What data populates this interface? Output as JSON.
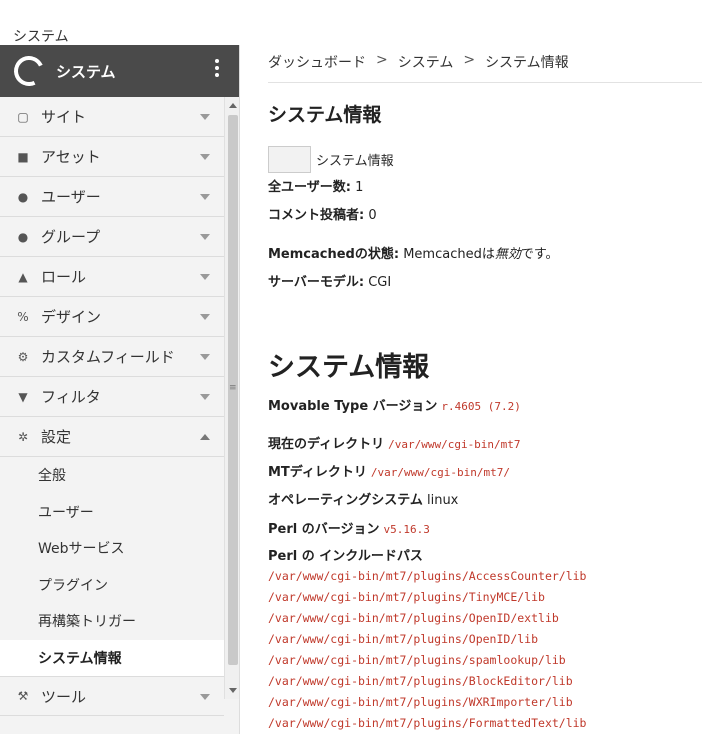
{
  "top_label": "システム",
  "sidebar": {
    "title": "システム",
    "items": [
      {
        "label": "サイト",
        "icon": "site-icon",
        "glyph": "▢"
      },
      {
        "label": "アセット",
        "icon": "asset-icon",
        "glyph": "■"
      },
      {
        "label": "ユーザー",
        "icon": "user-icon",
        "glyph": "●"
      },
      {
        "label": "グループ",
        "icon": "group-icon",
        "glyph": "●"
      },
      {
        "label": "ロール",
        "icon": "role-icon",
        "glyph": "▲"
      },
      {
        "label": "デザイン",
        "icon": "design-icon",
        "glyph": "%"
      },
      {
        "label": "カスタムフィールド",
        "icon": "custom-field-icon",
        "glyph": "⚙"
      },
      {
        "label": "フィルタ",
        "icon": "filter-icon",
        "glyph": "▼"
      },
      {
        "label": "設定",
        "icon": "gear-icon",
        "glyph": "✲",
        "expanded": true
      }
    ],
    "sub_items": [
      {
        "label": "全般"
      },
      {
        "label": "ユーザー"
      },
      {
        "label": "Webサービス"
      },
      {
        "label": "プラグイン"
      },
      {
        "label": "再構築トリガー"
      },
      {
        "label": "システム情報",
        "active": true
      }
    ],
    "tools": {
      "label": "ツール",
      "icon": "wrench-icon",
      "glyph": "🔧"
    }
  },
  "breadcrumb": [
    "ダッシュボード",
    "システム",
    "システム情報"
  ],
  "breadcrumb_sep": ">",
  "heading_small": "システム情報",
  "sysinfo_button_label": "システム情報",
  "stats": {
    "total_users_label": "全ユーザー数:",
    "total_users_value": "1",
    "commenters_label": "コメント投稿者:",
    "commenters_value": "0",
    "memcached_label": "Memcachedの状態:",
    "memcached_value_pre": "Memcachedは",
    "memcached_value_em": "無効",
    "memcached_value_post": "です。",
    "server_model_label": "サーバーモデル:",
    "server_model_value": "CGI"
  },
  "heading_big": "システム情報",
  "info": {
    "mt_version_label": "Movable Type バージョン",
    "mt_version_value": "r.4605 (7.2)",
    "cwd_label": "現在のディレクトリ",
    "cwd_value": "/var/www/cgi-bin/mt7",
    "mtdir_label": "MTディレクトリ",
    "mtdir_value": "/var/www/cgi-bin/mt7/",
    "os_label": "オペレーティングシステム",
    "os_value": "linux",
    "perl_version_label": "Perl のバージョン",
    "perl_version_value": "v5.16.3",
    "perl_include_label": "Perl の インクルードパス"
  },
  "include_paths": [
    "/var/www/cgi-bin/mt7/plugins/AccessCounter/lib",
    "/var/www/cgi-bin/mt7/plugins/TinyMCE/lib",
    "/var/www/cgi-bin/mt7/plugins/OpenID/extlib",
    "/var/www/cgi-bin/mt7/plugins/OpenID/lib",
    "/var/www/cgi-bin/mt7/plugins/spamlookup/lib",
    "/var/www/cgi-bin/mt7/plugins/BlockEditor/lib",
    "/var/www/cgi-bin/mt7/plugins/WXRImporter/lib",
    "/var/www/cgi-bin/mt7/plugins/FormattedText/lib"
  ]
}
